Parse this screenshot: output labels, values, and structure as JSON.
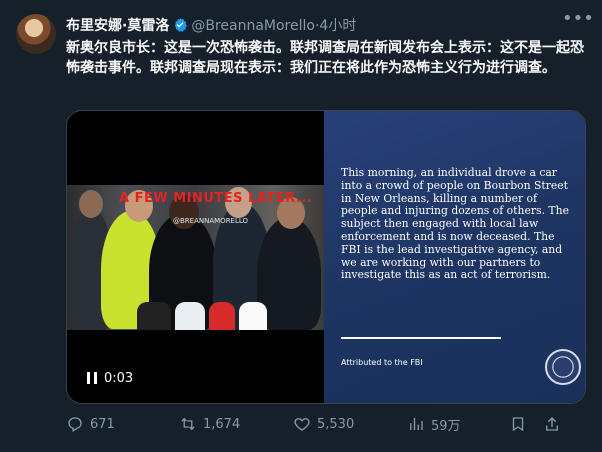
{
  "post": {
    "author_name": "布里安娜·莫雷洛",
    "author_handle": "@BreannaMorello",
    "separator": "·",
    "time": "4小时",
    "text": "新奥尔良市长：这是一次恐怖袭击。联邦调查局在新闻发布会上表示：这不是一起恐怖袭击事件。联邦调查局现在表示：我们正在将此作为恐怖主义行为进行调查。"
  },
  "media": {
    "overlay_text": "A FEW MINUTES LATER...",
    "watermark": "@BREANNAMORELLO",
    "video_time": "0:03",
    "fbi_statement": "This morning, an individual drove a car into a crowd of people on Bourbon Street in New Orleans, killing a number of people and injuring dozens of others. The subject then engaged with local law enforcement and is now deceased. The FBI is the lead investigative agency, and we are working with our partners to investigate this as an act of terrorism.",
    "attribution": "Attributed to the FBI"
  },
  "metrics": {
    "replies": "671",
    "reposts": "1,674",
    "likes": "5,530",
    "views": "59万"
  },
  "colors": {
    "background": "#15202b",
    "muted": "#8b98a5",
    "verified": "#1d9bf0",
    "overlay_red": "#e42323"
  },
  "icons": {
    "verified": "verified-badge-icon",
    "more": "more-icon",
    "pause": "pause-icon",
    "reply": "reply-icon",
    "repost": "repost-icon",
    "like": "like-icon",
    "views": "views-icon",
    "bookmark": "bookmark-icon",
    "share": "share-icon"
  }
}
